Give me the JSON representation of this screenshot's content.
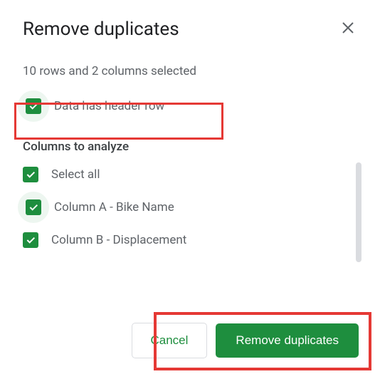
{
  "dialog": {
    "title": "Remove duplicates",
    "selection_info": "10 rows and 2 columns selected",
    "header_row_label": "Data has header row",
    "columns_section_title": "Columns to analyze",
    "select_all_label": "Select all",
    "columns": [
      {
        "label": "Column A - Bike Name"
      },
      {
        "label": "Column B - Displacement"
      }
    ],
    "cancel_label": "Cancel",
    "confirm_label": "Remove duplicates"
  }
}
